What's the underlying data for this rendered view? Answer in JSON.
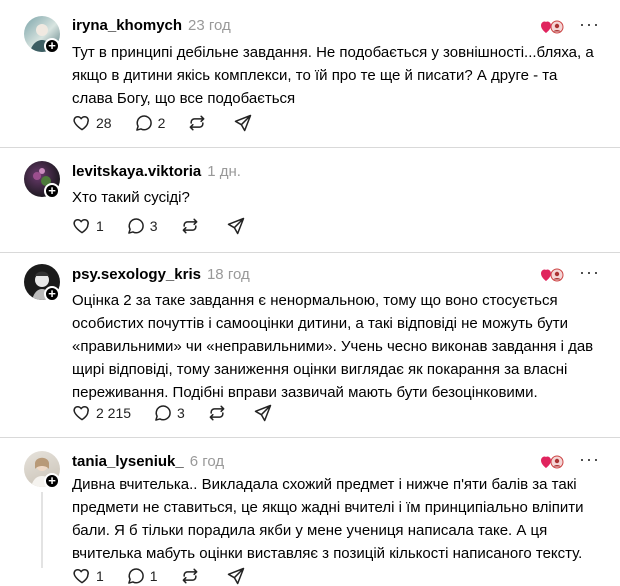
{
  "icons": {
    "like": "heart-outline-icon",
    "comment": "speech-bubble-icon",
    "repost": "repost-icon",
    "share": "send-icon",
    "more": "more-horizontal-icon"
  },
  "posts": [
    {
      "username": "iryna_khomych",
      "time": "23 год",
      "text": "Тут в принципі дебільне завдання. Не подобається у зовнішності...бляха, а якщо в дитини якісь комплекси, то їй про те ще й писати? А друге - та слава Богу, що все подобається",
      "likes": "28",
      "comments": "2",
      "more": "···"
    },
    {
      "username": "levitskaya.viktoria",
      "time": "1 дн.",
      "text": "Хто такий сусіді?",
      "likes": "1",
      "comments": "3",
      "more": "···"
    },
    {
      "username": "psy.sexology_kris",
      "time": "18 год",
      "text": "Оцінка 2 за таке завдання є ненормальною, тому що воно стосується особистих почуттів і самооцінки дитини, а такі відповіді не можуть бути «правильними» чи «неправильними». Учень чесно виконав завдання і дав щирі відповіді, тому заниження оцінки виглядає як покарання за власні переживання. Подібні вправи зазвичай мають бути безоцінковими.",
      "likes": "2 215",
      "comments": "3",
      "more": "···"
    },
    {
      "username": "tania_lyseniuk_",
      "time": "6 год",
      "text": "Дивна вчителька.. Викладала схожий предмет і нижче п'яти балів за такі предмети не ставиться, це якщо жадні вчителі і їм принципіально вліпити бали. Я б тільки порадила якби у мене учениця написала таке. А ця вчителька мабуть оцінки виставляє з позицій кількості написаного тексту.",
      "likes": "1",
      "comments": "1",
      "more": "···"
    }
  ]
}
